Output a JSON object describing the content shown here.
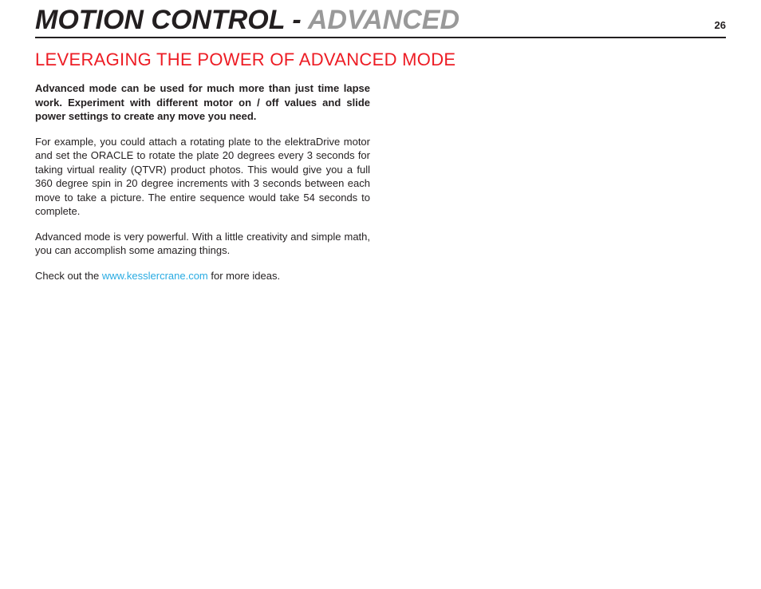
{
  "header": {
    "title_part1": "MOTION CONTROL - ",
    "title_part2": "ADVANCED",
    "page_number": "26"
  },
  "subheading": "LEVERAGING THE POWER OF ADVANCED MODE",
  "intro": "Advanced mode can be used for much more than just time lapse work. Experiment with different motor on / off values and slide power settings to create any move you need.",
  "para1": "For example, you could attach a rotating plate to the elektraDrive motor and set the ORACLE to rotate the plate 20 degrees every 3 seconds for taking virtual reality (QTVR) product photos. This would give you a full 360 degree spin in 20 degree increments with 3 seconds between each move to take a picture. The entire sequence would take 54 seconds to complete.",
  "para2": "Advanced mode is very powerful. With a little creativity and simple math, you can accomplish some amazing things.",
  "closing_pre": "Check out the ",
  "closing_link": "www.kesslercrane.com",
  "closing_post": " for more ideas."
}
